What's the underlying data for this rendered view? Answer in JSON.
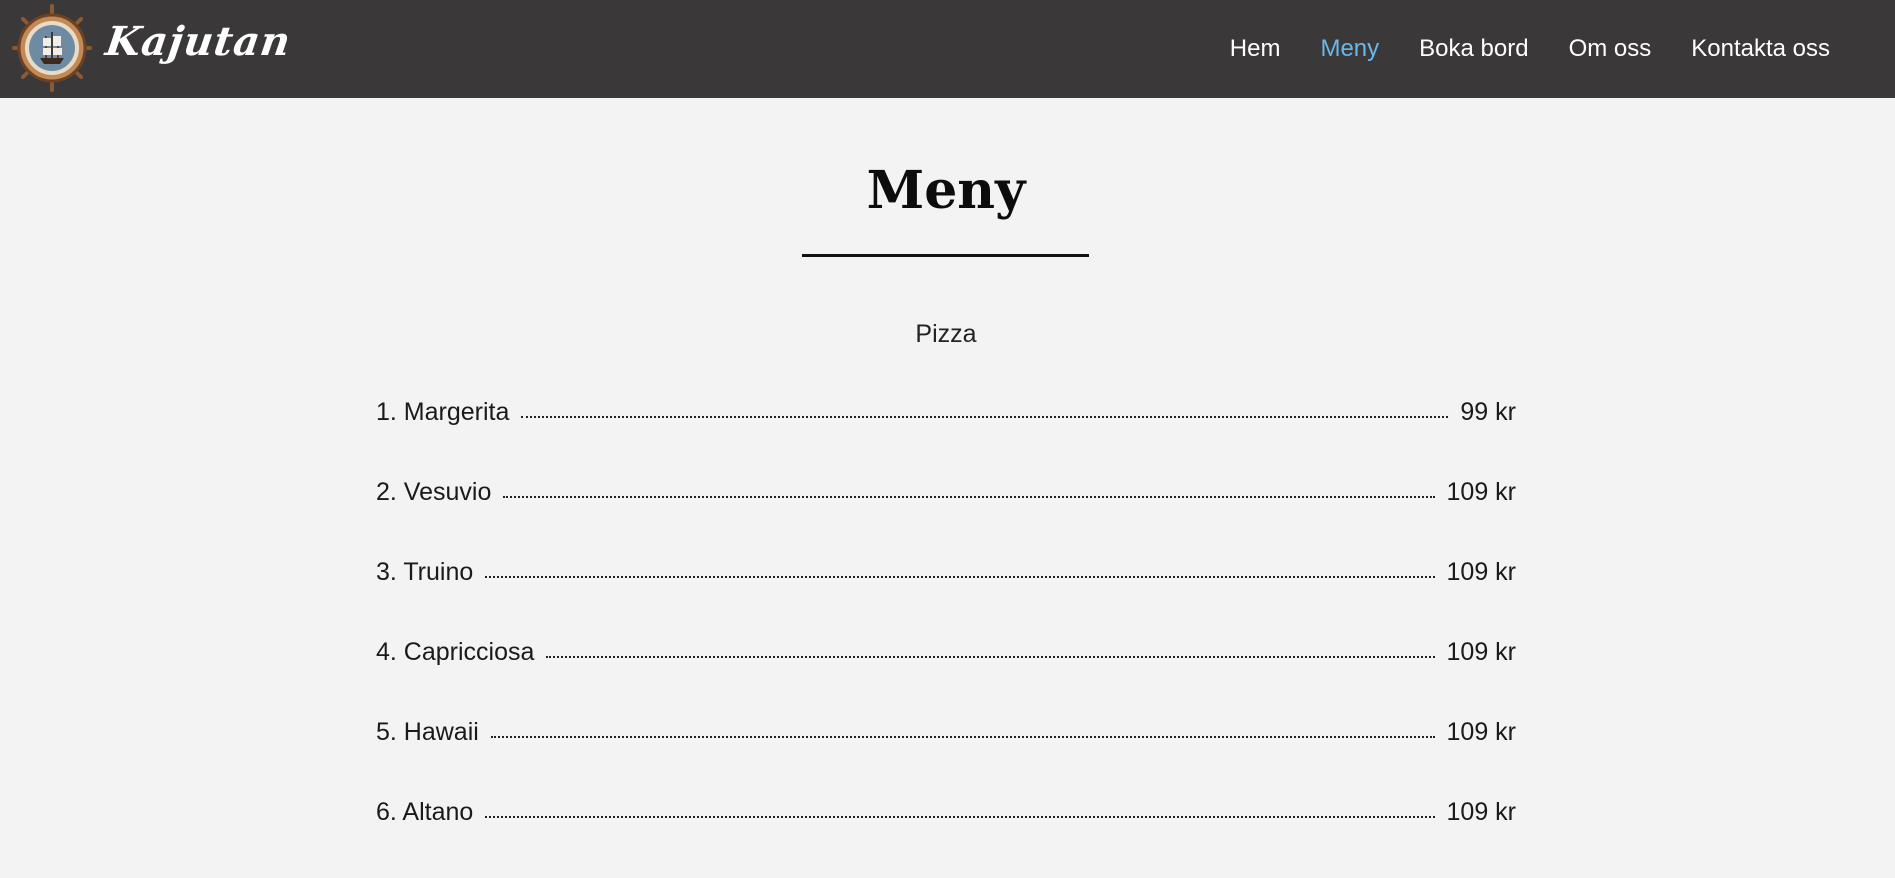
{
  "header": {
    "brand": "Kajutan",
    "logo_icon": "ship-wheel-icon",
    "nav": [
      {
        "label": "Hem",
        "active": false
      },
      {
        "label": "Meny",
        "active": true
      },
      {
        "label": "Boka bord",
        "active": false
      },
      {
        "label": "Om oss",
        "active": false
      },
      {
        "label": "Kontakta oss",
        "active": false
      }
    ],
    "colors": {
      "background": "#3a3839",
      "active": "#6db6ea"
    }
  },
  "main": {
    "title": "Meny",
    "section": "Pizza",
    "items": [
      {
        "name": "1. Margerita",
        "price": "99 kr"
      },
      {
        "name": "2. Vesuvio",
        "price": "109 kr"
      },
      {
        "name": "3. Truino",
        "price": "109 kr"
      },
      {
        "name": "4. Capricciosa",
        "price": "109 kr"
      },
      {
        "name": "5. Hawaii",
        "price": "109 kr"
      },
      {
        "name": "6. Altano",
        "price": "109 kr"
      }
    ]
  }
}
